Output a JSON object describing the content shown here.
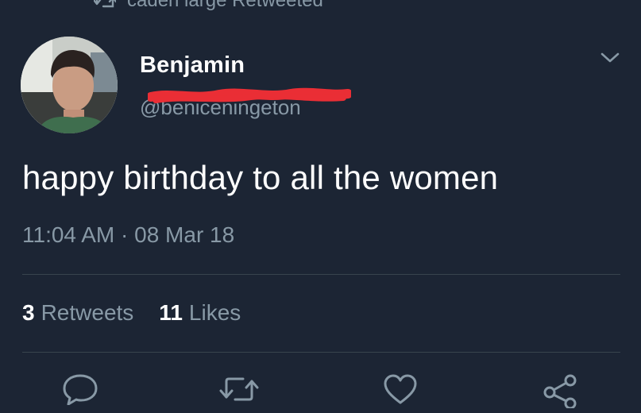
{
  "retweet_context": {
    "icon": "retweet-icon",
    "text": "caden large Retweeted"
  },
  "tweet": {
    "author": {
      "display_name": "Benjamin",
      "handle": "@beniceningeton",
      "handle_redacted": true,
      "avatar_icon": "avatar-photo"
    },
    "menu_icon": "chevron-down-icon",
    "text": "happy birthday to all the women",
    "time": "11:04 AM",
    "separator": "·",
    "date": "08 Mar 18",
    "stats": {
      "retweets_count": "3",
      "retweets_label": "Retweets",
      "likes_count": "11",
      "likes_label": "Likes"
    }
  },
  "actions": [
    {
      "name": "reply",
      "icon": "reply-icon"
    },
    {
      "name": "retweet",
      "icon": "retweet-icon"
    },
    {
      "name": "like",
      "icon": "heart-icon"
    },
    {
      "name": "share",
      "icon": "share-icon"
    }
  ],
  "colors": {
    "background": "#1c2534",
    "primary_text": "#ffffff",
    "secondary_text": "#8899a6",
    "divider": "#38444d",
    "redaction": "#ea2e35"
  }
}
